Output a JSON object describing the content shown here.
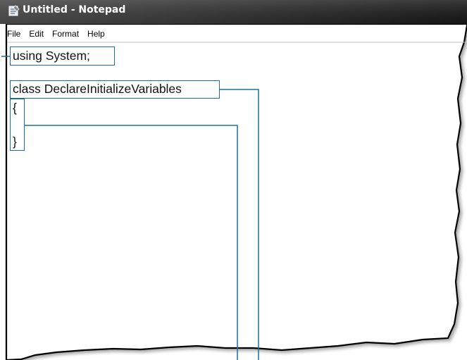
{
  "window": {
    "title": "Untitled - Notepad",
    "title_color": "#1a1a1a",
    "app_icon": "notepad-icon"
  },
  "menu": {
    "items": [
      "File",
      "Edit",
      "Format",
      "Help"
    ]
  },
  "editor": {
    "lines": [
      "using System;",
      "class DeclareInitializeVariables",
      "{",
      "}"
    ]
  },
  "colors": {
    "callout": "#1f6f9b",
    "titlebar_gradient_start": "#4a4a4a",
    "titlebar_gradient_end": "#111111"
  }
}
